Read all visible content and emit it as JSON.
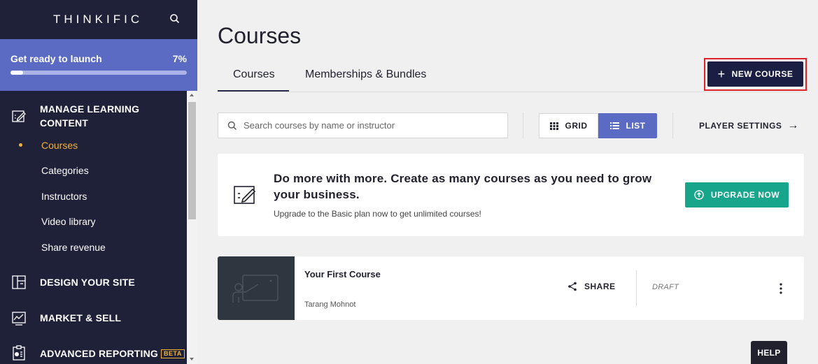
{
  "sidebar": {
    "logo": "THINKIFIC",
    "launch": {
      "label": "Get ready to launch",
      "percent_text": "7%",
      "progress": 0.07
    },
    "sections": [
      {
        "label_line1": "MANAGE LEARNING",
        "label_line2": "CONTENT",
        "icon": "edit-content-icon"
      },
      {
        "label": "DESIGN YOUR SITE",
        "icon": "layout-icon"
      },
      {
        "label": "MARKET & SELL",
        "icon": "chart-icon"
      },
      {
        "label": "ADVANCED REPORTING",
        "badge": "BETA",
        "icon": "clipboard-report-icon"
      }
    ],
    "sub_items": [
      "Courses",
      "Categories",
      "Instructors",
      "Video library",
      "Share revenue"
    ]
  },
  "main": {
    "title": "Courses",
    "tabs": [
      {
        "label": "Courses",
        "active": true
      },
      {
        "label": "Memberships & Bundles",
        "active": false
      }
    ],
    "new_course_label": "NEW COURSE",
    "search_placeholder": "Search courses by name or instructor",
    "view_toggle": {
      "grid_label": "GRID",
      "list_label": "LIST",
      "selected": "LIST"
    },
    "player_settings_label": "PLAYER SETTINGS"
  },
  "upgrade": {
    "heading": "Do more with more. Create as many courses as you need to grow your business.",
    "subtext": "Upgrade to the Basic plan now to get unlimited courses!",
    "button_label": "UPGRADE NOW"
  },
  "course": {
    "title": "Your First Course",
    "author": "Tarang Mohnot",
    "share_label": "SHARE",
    "status": "DRAFT"
  },
  "help_label": "HELP",
  "colors": {
    "sidebar_bg": "#1f2139",
    "launch_bg": "#5b6bc4",
    "accent_yellow": "#f3b234",
    "primary_navy": "#1b1e43",
    "list_active": "#5b6bc4",
    "upgrade_green": "#17a58c",
    "highlight_red": "#e0202b"
  }
}
